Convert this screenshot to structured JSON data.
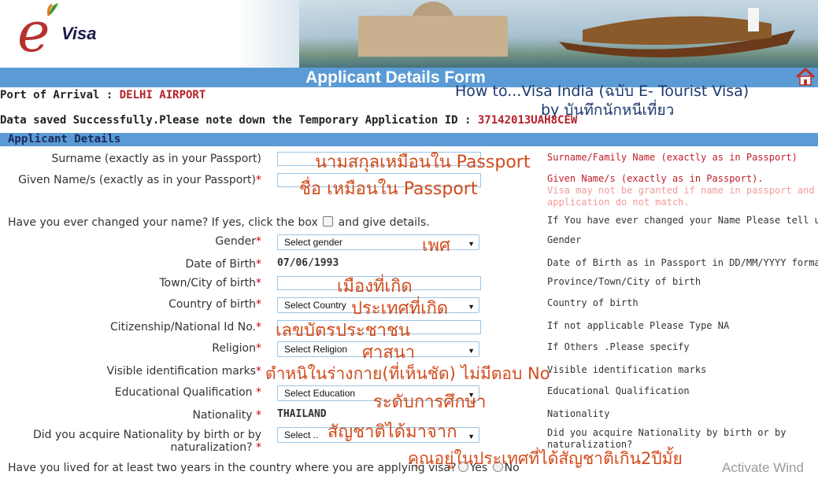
{
  "header": {
    "logo_e": "e",
    "logo_visa": "Visa",
    "title": "Applicant Details Form",
    "overlay_line1": "How to...Visa India (ฉบับ E- Tourist Visa)",
    "overlay_line2": "by บันทึกนักหนีเที่ยว"
  },
  "info": {
    "port_label": "Port of Arrival : ",
    "port_value": "DELHI AIRPORT",
    "saved_text": "Data saved Successfully.Please note down the Temporary Application ID : ",
    "app_id": "37142013UAH8CEW"
  },
  "section": {
    "title": "Applicant Details"
  },
  "form": {
    "surname": {
      "label": "Surname (exactly as in your Passport)",
      "hint": "Surname/Family Name (exactly as in Passport)",
      "annot": "นามสกุลเหมือนใน Passport"
    },
    "given": {
      "label": "Given Name/s (exactly as in your Passport)",
      "star": "*",
      "hint": "Given Name/s (exactly as in Passport).",
      "hint2": "Visa may not be granted if name in passport and",
      "hint3": "application do not match.",
      "annot": "ชื่อ เหมือนใน Passport"
    },
    "changed": {
      "label_a": "Have you ever changed your name? If yes, click the box ",
      "label_b": " and give details.",
      "hint": "If You have ever changed your Name Please tell us."
    },
    "gender": {
      "label": "Gender",
      "star": "*",
      "value": "Select gender",
      "hint": "Gender",
      "annot": "เพศ"
    },
    "dob": {
      "label": "Date of Birth",
      "star": "*",
      "value": "07/06/1993",
      "hint": "Date of Birth as in Passport in DD/MM/YYYY format"
    },
    "town": {
      "label": "Town/City of birth",
      "star": "*",
      "hint": "Province/Town/City of birth",
      "annot": "เมืองที่เกิด"
    },
    "country": {
      "label": "Country of birth",
      "star": "*",
      "value": "Select Country",
      "hint": "Country of birth",
      "annot": "ประเทศที่เกิด"
    },
    "citizen": {
      "label": "Citizenship/National Id No.",
      "star": "*",
      "hint": "If not applicable Please Type NA",
      "annot": "เลขบัตรประชาชน"
    },
    "religion": {
      "label": "Religion",
      "star": "*",
      "value": "Select Religion",
      "hint": "If Others .Please specify",
      "annot": "ศาสนา"
    },
    "marks": {
      "label": "Visible identification marks",
      "star": "*",
      "hint": "Visible identification marks",
      "annot": "ตำหนิในร่างกาย(ที่เห็นชัด) ไม่มีตอบ No"
    },
    "education": {
      "label": "Educational Qualification ",
      "star": "*",
      "value": "Select Education",
      "hint": "Educational Qualification",
      "annot": "ระดับการศึกษา"
    },
    "nationality": {
      "label": "Nationality ",
      "star": "*",
      "value": "THAILAND",
      "hint": "Nationality"
    },
    "acquire": {
      "label1": "Did you acquire Nationality by birth or by",
      "label2": "naturalization? ",
      "star": "*",
      "value": "Select ..",
      "hint1": "Did you acquire Nationality by birth or by",
      "hint2": "naturalization?",
      "annot": "สัญชาติได้มาจาก"
    },
    "lived": {
      "label": "Have you lived for at least two years in the country where you are applying visa?",
      "yes": "Yes",
      "no": "No",
      "annot": "คุณอยู่ในประเทศที่ได้สัญชาติเกิน2ปีมั้ย"
    }
  },
  "watermark": "Activate Wind"
}
